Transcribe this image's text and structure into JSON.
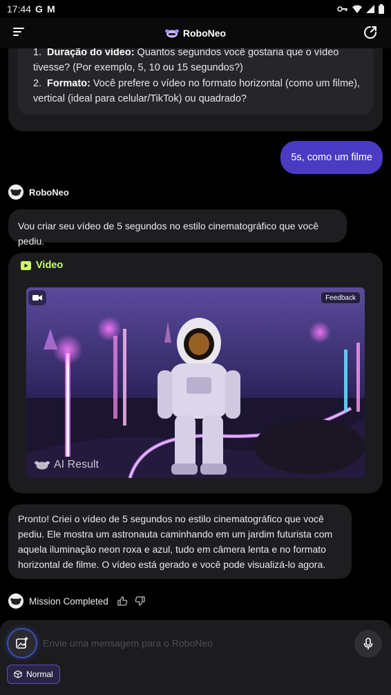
{
  "status_bar": {
    "time": "17:44",
    "notif_g": "G",
    "notif_m": "M"
  },
  "app": {
    "brand": "RoboNeo"
  },
  "prev_card": {
    "items": [
      {
        "num": "1.",
        "bold": "Duração do vídeo:",
        "text": " Quantos segundos você gostaria que o vídeo tivesse? (Por exemplo, 5, 10 ou 15 segundos?)"
      },
      {
        "num": "2.",
        "bold": "Formato:",
        "text": " Você prefere o vídeo no formato horizontal (como um filme), vertical (ideal para celular/TikTok) ou quadrado?"
      }
    ]
  },
  "user_message": "5s, como um filme",
  "bot": {
    "name": "RoboNeo",
    "reply1": "Vou criar seu vídeo de 5 segundos no estilo cinematográfico que você pediu.",
    "reply2": "Pronto! Criei o vídeo de 5 segundos no estilo cinematográfico que você pediu. Ele mostra um astronauta caminhando em um jardim futurista com aquela iluminação neon roxa e azul, tudo em câmera lenta e no formato horizontal de filme. O vídeo está gerado e você pode visualizá-lo agora."
  },
  "video_card": {
    "title": "Video",
    "feedback": "Feedback",
    "watermark": "AI Result"
  },
  "mission": {
    "label": "Mission Completed"
  },
  "composer": {
    "placeholder": "Envie uma mensagem para o RoboNeo",
    "mode": "Normal"
  },
  "colors": {
    "user_bubble": "#4a3bc2",
    "video_title": "#c8ff6a",
    "bubble_bg": "#1e1e21"
  }
}
